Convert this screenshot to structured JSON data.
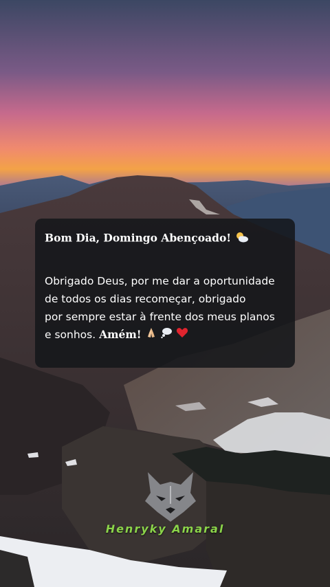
{
  "card": {
    "title": "Bom Dia, Domingo Abençoado!",
    "title_icon": "sun-behind-cloud-icon",
    "body_line1": "Obrigado Deus, por me dar a oportunidade",
    "body_line2": "de todos os dias recomeçar, obrigado",
    "body_line3": "por sempre estar à frente dos meus planos",
    "body_line4_start": "e sonhos.",
    "body_line4_bold": "Amém!",
    "end_icons": [
      "praying-hands-icon",
      "thought-balloon-icon",
      "red-heart-icon"
    ]
  },
  "watermark": {
    "logo_icon": "wolf-head-icon",
    "name": "Henryky Amaral",
    "color": "#8bd44a"
  }
}
